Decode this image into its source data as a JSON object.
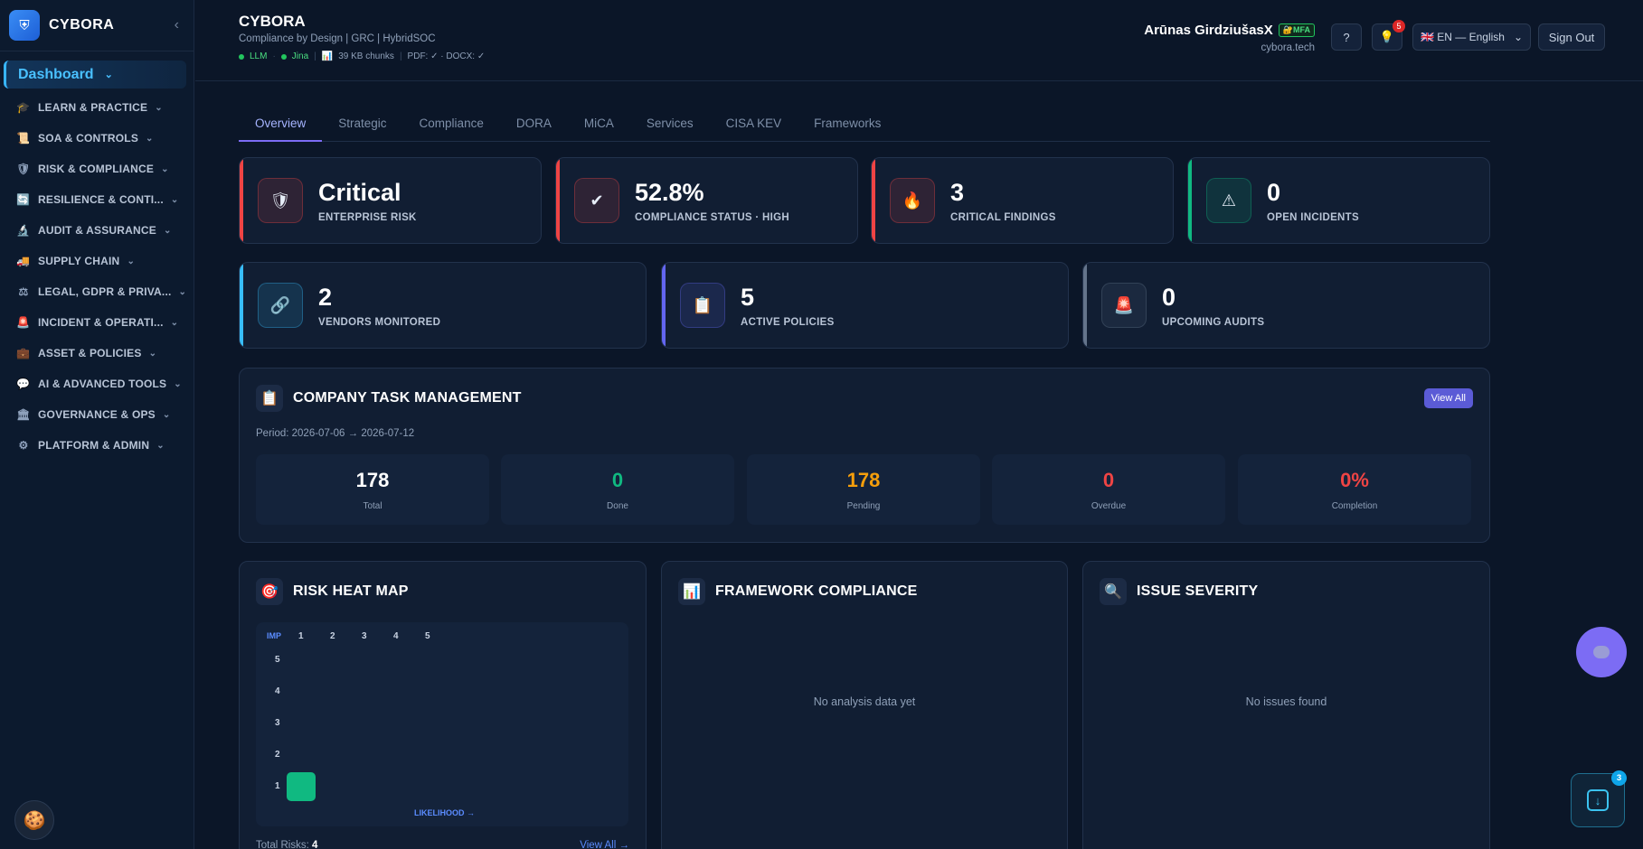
{
  "brand": {
    "name": "CYBORA",
    "logo_icon": "shield-icon"
  },
  "sidebar": {
    "active": {
      "label": "Dashboard"
    },
    "items": [
      {
        "label": "LEARN & PRACTICE",
        "icon": "🎓"
      },
      {
        "label": "SOA & CONTROLS",
        "icon": "📜"
      },
      {
        "label": "RISK & COMPLIANCE",
        "icon": "🛡"
      },
      {
        "label": "RESILIENCE & CONTI...",
        "icon": "🔄"
      },
      {
        "label": "AUDIT & ASSURANCE",
        "icon": "🔬"
      },
      {
        "label": "SUPPLY CHAIN",
        "icon": "🚚"
      },
      {
        "label": "LEGAL, GDPR & PRIVA...",
        "icon": "⚖"
      },
      {
        "label": "INCIDENT & OPERATI...",
        "icon": "🚨"
      },
      {
        "label": "ASSET & POLICIES",
        "icon": "💼"
      },
      {
        "label": "AI & ADVANCED TOOLS",
        "icon": "💬"
      },
      {
        "label": "GOVERNANCE & OPS",
        "icon": "🏛"
      },
      {
        "label": "PLATFORM & ADMIN",
        "icon": "⚙"
      }
    ],
    "cookie_icon": "🍪"
  },
  "header": {
    "title": "CYBORA",
    "subtitle": "Compliance by Design | GRC | HybridSOC",
    "status": {
      "llm": "LLM",
      "jina": "Jina",
      "chunks": "39 KB chunks",
      "docs": "PDF: ✓ · DOCX: ✓"
    },
    "user": {
      "name": "Arūnas GirdziušasX",
      "mfa": "MFA",
      "domain": "cybora.tech"
    },
    "help_label": "?",
    "notif_count": "5",
    "language": "EN — English",
    "signout_label": "Sign Out"
  },
  "tabs": [
    "Overview",
    "Strategic",
    "Compliance",
    "DORA",
    "MiCA",
    "Services",
    "CISA KEV",
    "Frameworks"
  ],
  "kpis_row1": [
    {
      "value": "Critical",
      "label": "ENTERPRISE RISK",
      "icon": "🛡",
      "accent": "#ef4444"
    },
    {
      "value": "52.8%",
      "label": "COMPLIANCE STATUS · HIGH",
      "icon": "✔",
      "accent": "#ef4444"
    },
    {
      "value": "3",
      "label": "CRITICAL FINDINGS",
      "icon": "🔥",
      "accent": "#ef4444"
    },
    {
      "value": "0",
      "label": "OPEN INCIDENTS",
      "icon": "⚠",
      "accent": "#10b981"
    }
  ],
  "kpis_row2": [
    {
      "value": "2",
      "label": "VENDORS MONITORED",
      "icon": "🔗",
      "accent": "#38bdf8"
    },
    {
      "value": "5",
      "label": "ACTIVE POLICIES",
      "icon": "📋",
      "accent": "#6366f1"
    },
    {
      "value": "0",
      "label": "UPCOMING AUDITS",
      "icon": "🚨",
      "accent": "#64748b"
    }
  ],
  "tasks": {
    "title": "COMPANY TASK MANAGEMENT",
    "icon": "📋",
    "view_all": "View All",
    "period": "Period: 2026-07-06 → 2026-07-12",
    "stats": [
      {
        "value": "178",
        "label": "Total",
        "color": "#ffffff"
      },
      {
        "value": "0",
        "label": "Done",
        "color": "#10b981"
      },
      {
        "value": "178",
        "label": "Pending",
        "color": "#f59e0b"
      },
      {
        "value": "0",
        "label": "Overdue",
        "color": "#ef4444"
      },
      {
        "value": "0%",
        "label": "Completion",
        "color": "#ef4444"
      }
    ]
  },
  "heatmap": {
    "title": "RISK HEAT MAP",
    "icon": "🎯",
    "imp_label": "IMP",
    "columns": [
      "1",
      "2",
      "3",
      "4",
      "5"
    ],
    "rows": [
      "5",
      "4",
      "3",
      "2",
      "1"
    ],
    "x_label": "LIKELIHOOD →",
    "total_label": "Total Risks:",
    "total_value": "4",
    "link": "View All →"
  },
  "framework": {
    "title": "FRAMEWORK COMPLIANCE",
    "icon": "📊",
    "empty": "No analysis data yet"
  },
  "severity": {
    "title": "ISSUE SEVERITY",
    "icon": "🔍",
    "empty": "No issues found"
  },
  "install_badge": "3"
}
